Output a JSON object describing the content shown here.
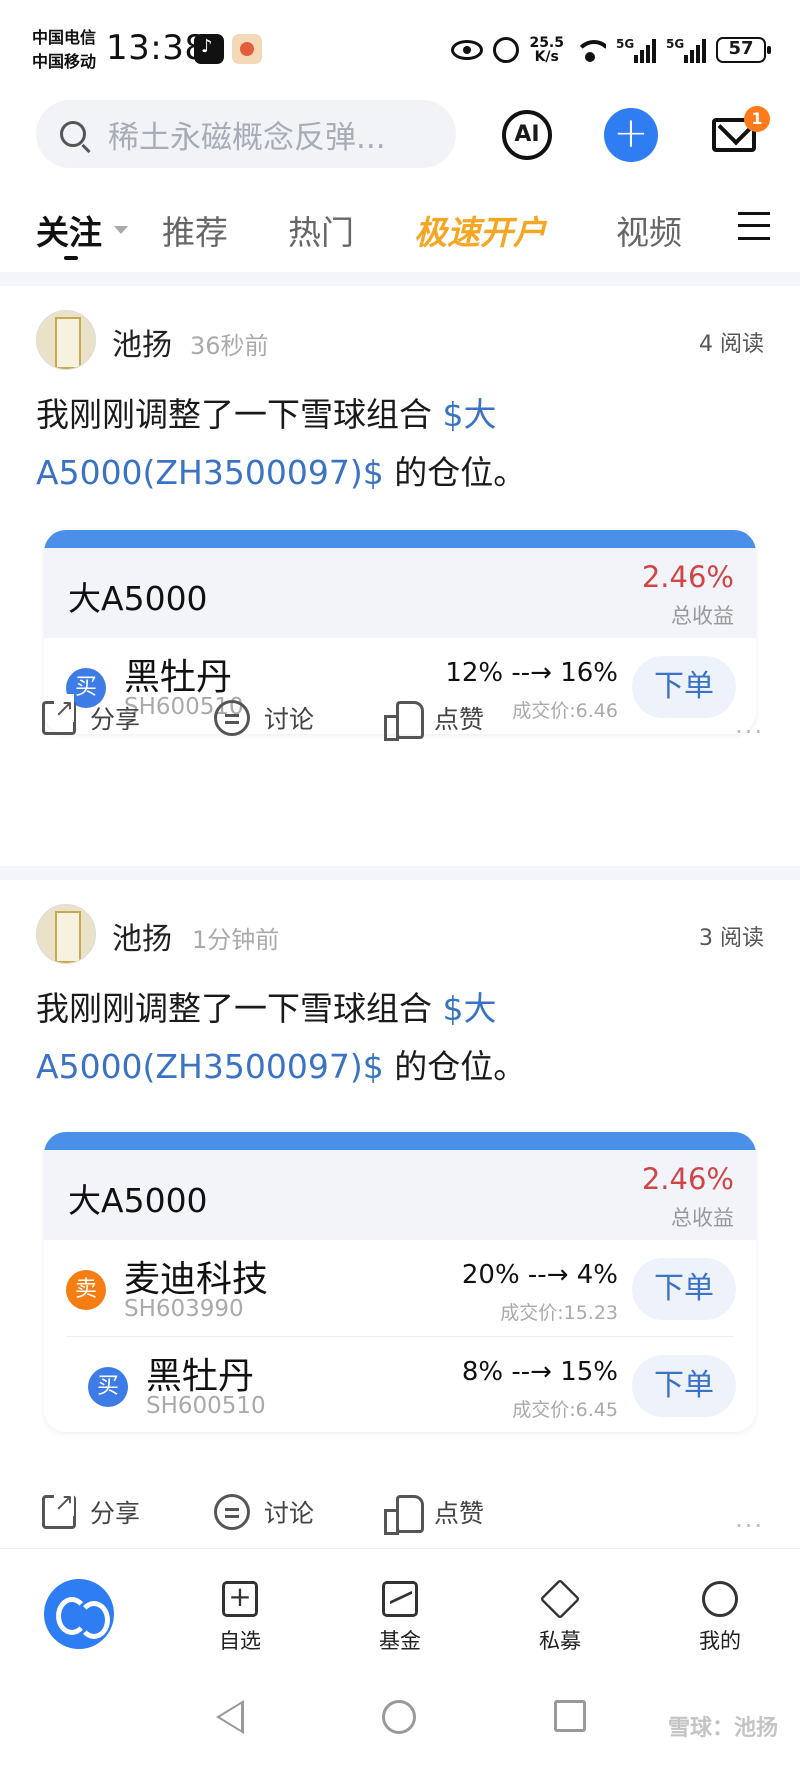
{
  "status_bar": {
    "carrier1": "中国电信",
    "carrier2": "中国移动",
    "time": "13:38",
    "net_speed_value": "25.5",
    "net_speed_unit": "K/s",
    "signal1": "5G",
    "signal2": "5G",
    "battery": "57"
  },
  "header": {
    "search_placeholder": "稀土永磁概念反弹...",
    "ai_label": "AI",
    "add_label": "+",
    "mail_badge": "1"
  },
  "tabs": [
    {
      "label": "关注"
    },
    {
      "label": "推荐"
    },
    {
      "label": "热门"
    },
    {
      "label": "极速开户"
    },
    {
      "label": "视频"
    }
  ],
  "posts": [
    {
      "author": "池扬",
      "time": "36秒前",
      "reads": "4 阅读",
      "text_prefix": "我刚刚调整了一下雪球组合 ",
      "text_link": "$大A5000(ZH3500097)$",
      "text_suffix": " 的仓位。",
      "card": {
        "name": "大A5000",
        "return": "2.46%",
        "return_label": "总收益",
        "trades": [
          {
            "side": "买",
            "name": "黑牡丹",
            "code": "SH600510",
            "weight": "12% --→ 16%",
            "price": "成交价:6.46",
            "button": "下单"
          }
        ]
      },
      "actions": {
        "share": "分享",
        "comment": "讨论",
        "like": "点赞",
        "more": "···"
      }
    },
    {
      "author": "池扬",
      "time": "1分钟前",
      "reads": "3 阅读",
      "text_prefix": "我刚刚调整了一下雪球组合 ",
      "text_link": "$大A5000(ZH3500097)$",
      "text_suffix": " 的仓位。",
      "card": {
        "name": "大A5000",
        "return": "2.46%",
        "return_label": "总收益",
        "trades": [
          {
            "side": "卖",
            "name": "麦迪科技",
            "code": "SH603990",
            "weight": "20% --→ 4%",
            "price": "成交价:15.23",
            "button": "下单"
          },
          {
            "side": "买",
            "name": "黑牡丹",
            "code": "SH600510",
            "weight": "8% --→ 15%",
            "price": "成交价:6.45",
            "button": "下单"
          }
        ]
      },
      "actions": {
        "share": "分享",
        "comment": "讨论",
        "like": "点赞",
        "more": "···"
      }
    }
  ],
  "bottom_nav": [
    {
      "label": "自选",
      "icon": "plus-square-icon"
    },
    {
      "label": "基金",
      "icon": "chart-square-icon"
    },
    {
      "label": "私募",
      "icon": "diamond-icon"
    },
    {
      "label": "我的",
      "icon": "user-icon"
    }
  ],
  "watermark": "雪球：池扬",
  "colors": {
    "accent_blue": "#2e7df2",
    "link_blue": "#3a73c4",
    "return_red": "#d04545",
    "highlight_orange": "#f5a623",
    "buy_blue": "#3d7be6",
    "sell_orange": "#f57d12"
  }
}
